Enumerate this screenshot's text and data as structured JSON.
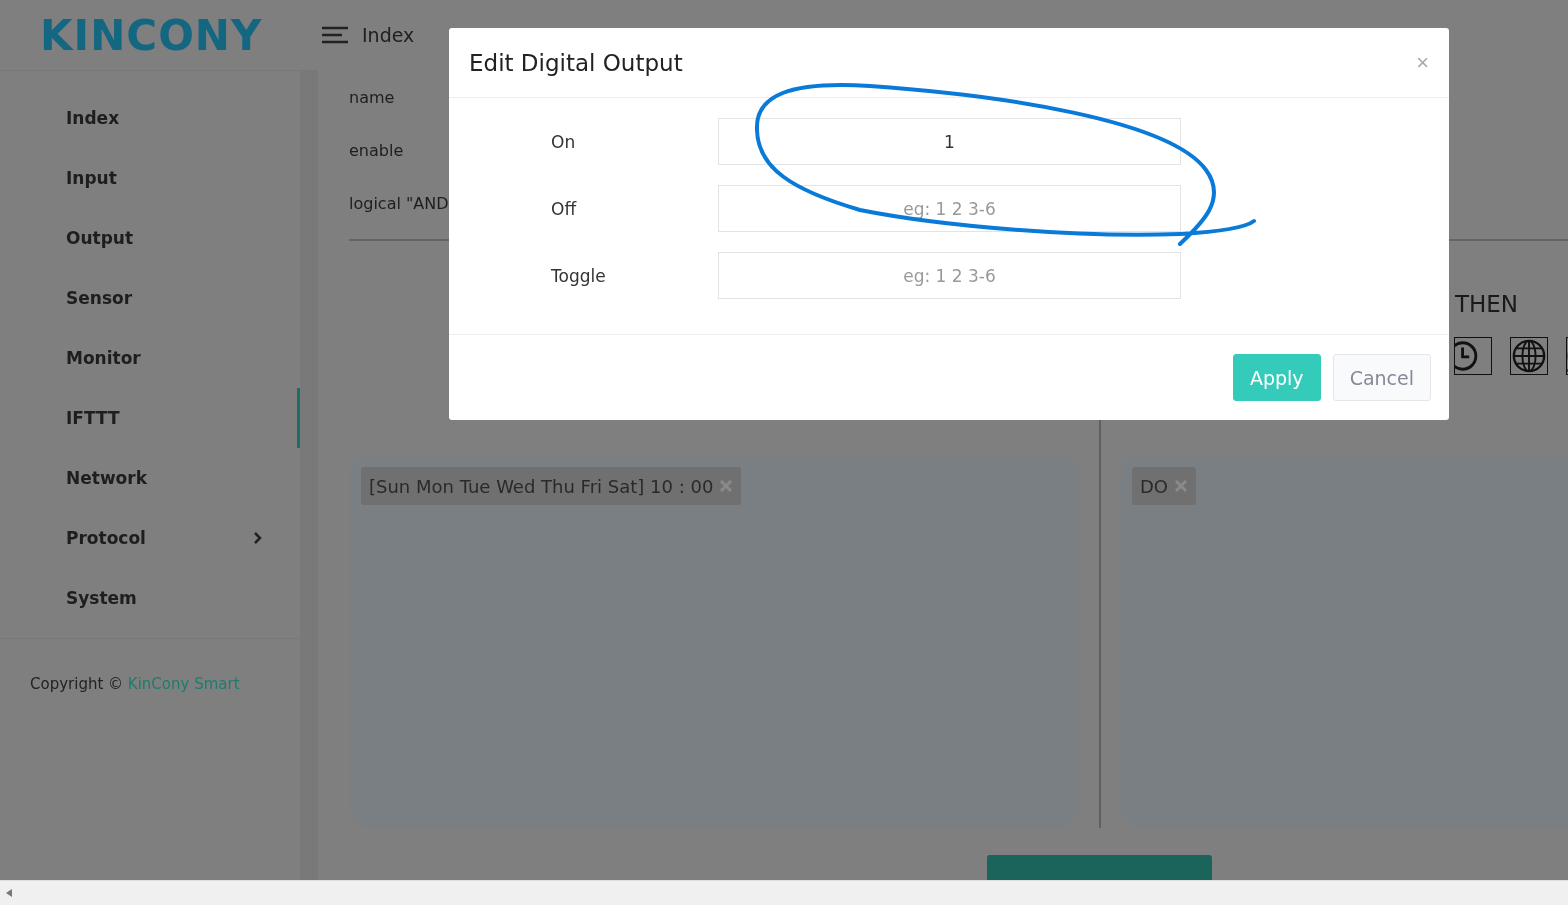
{
  "logo": "KINCONY",
  "header": {
    "title": "Index"
  },
  "sidebar": {
    "items": [
      {
        "label": "Index",
        "selected": false,
        "has_submenu": false
      },
      {
        "label": "Input",
        "selected": false,
        "has_submenu": false
      },
      {
        "label": "Output",
        "selected": false,
        "has_submenu": false
      },
      {
        "label": "Sensor",
        "selected": false,
        "has_submenu": false
      },
      {
        "label": "Monitor",
        "selected": false,
        "has_submenu": false
      },
      {
        "label": "IFTTT",
        "selected": true,
        "has_submenu": false
      },
      {
        "label": "Network",
        "selected": false,
        "has_submenu": false
      },
      {
        "label": "Protocol",
        "selected": false,
        "has_submenu": true
      },
      {
        "label": "System",
        "selected": false,
        "has_submenu": false
      }
    ],
    "copyright": "Copyright ©",
    "copyright_link": "KinCony Smart"
  },
  "rule_form": {
    "fields": [
      "name",
      "enable",
      "logical \"AND"
    ],
    "then_label": "THEN",
    "if_tags": [
      {
        "label": "[Sun Mon Tue Wed Thu Fri Sat] 10 : 00"
      }
    ],
    "then_tags": [
      {
        "label": "DO"
      }
    ]
  },
  "dialog": {
    "title": "Edit Digital Output",
    "close": "×",
    "fields": [
      {
        "label": "On",
        "value": "1"
      },
      {
        "label": "Off",
        "placeholder": "eg: 1 2 3-6"
      },
      {
        "label": "Toggle",
        "placeholder": "eg: 1 2 3-6"
      }
    ],
    "buttons": [
      {
        "label": "Apply",
        "kind": "primary"
      },
      {
        "label": "Cancel",
        "kind": "secondary"
      }
    ]
  }
}
